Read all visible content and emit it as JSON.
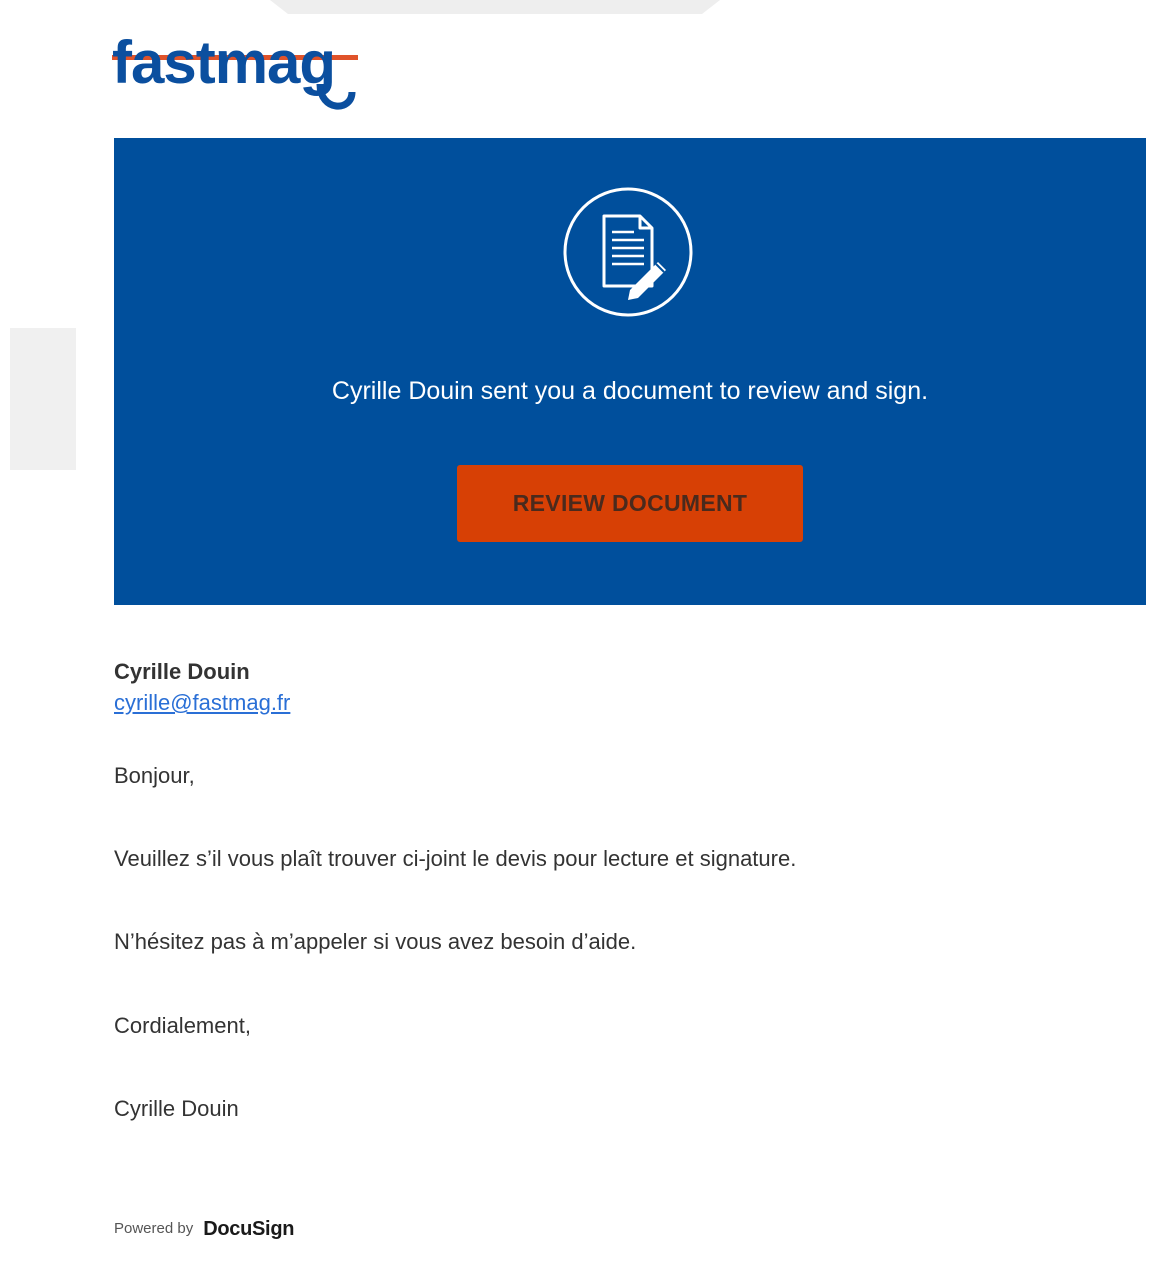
{
  "brand": {
    "logo_text": "fastmag",
    "logo_colors": {
      "blue": "#0b4f9f",
      "orange": "#e0532a"
    }
  },
  "banner": {
    "background": "#004f9c",
    "icon": "document-sign-icon",
    "message": "Cyrille Douin sent you a document to review and sign.",
    "button_label": "REVIEW DOCUMENT",
    "button_color": "#d74005"
  },
  "sender": {
    "name": "Cyrille Douin",
    "email": "cyrille@fastmag.fr"
  },
  "body": {
    "greeting": "Bonjour,",
    "line1": "Veuillez s’il vous plaît trouver ci-joint le devis pour lecture et signature.",
    "line2": "N’hésitez pas à m’appeler si vous avez besoin d’aide.",
    "closing": "Cordialement,",
    "signature": "Cyrille Douin"
  },
  "footer": {
    "powered_by": "Powered by",
    "provider": "DocuSign"
  }
}
